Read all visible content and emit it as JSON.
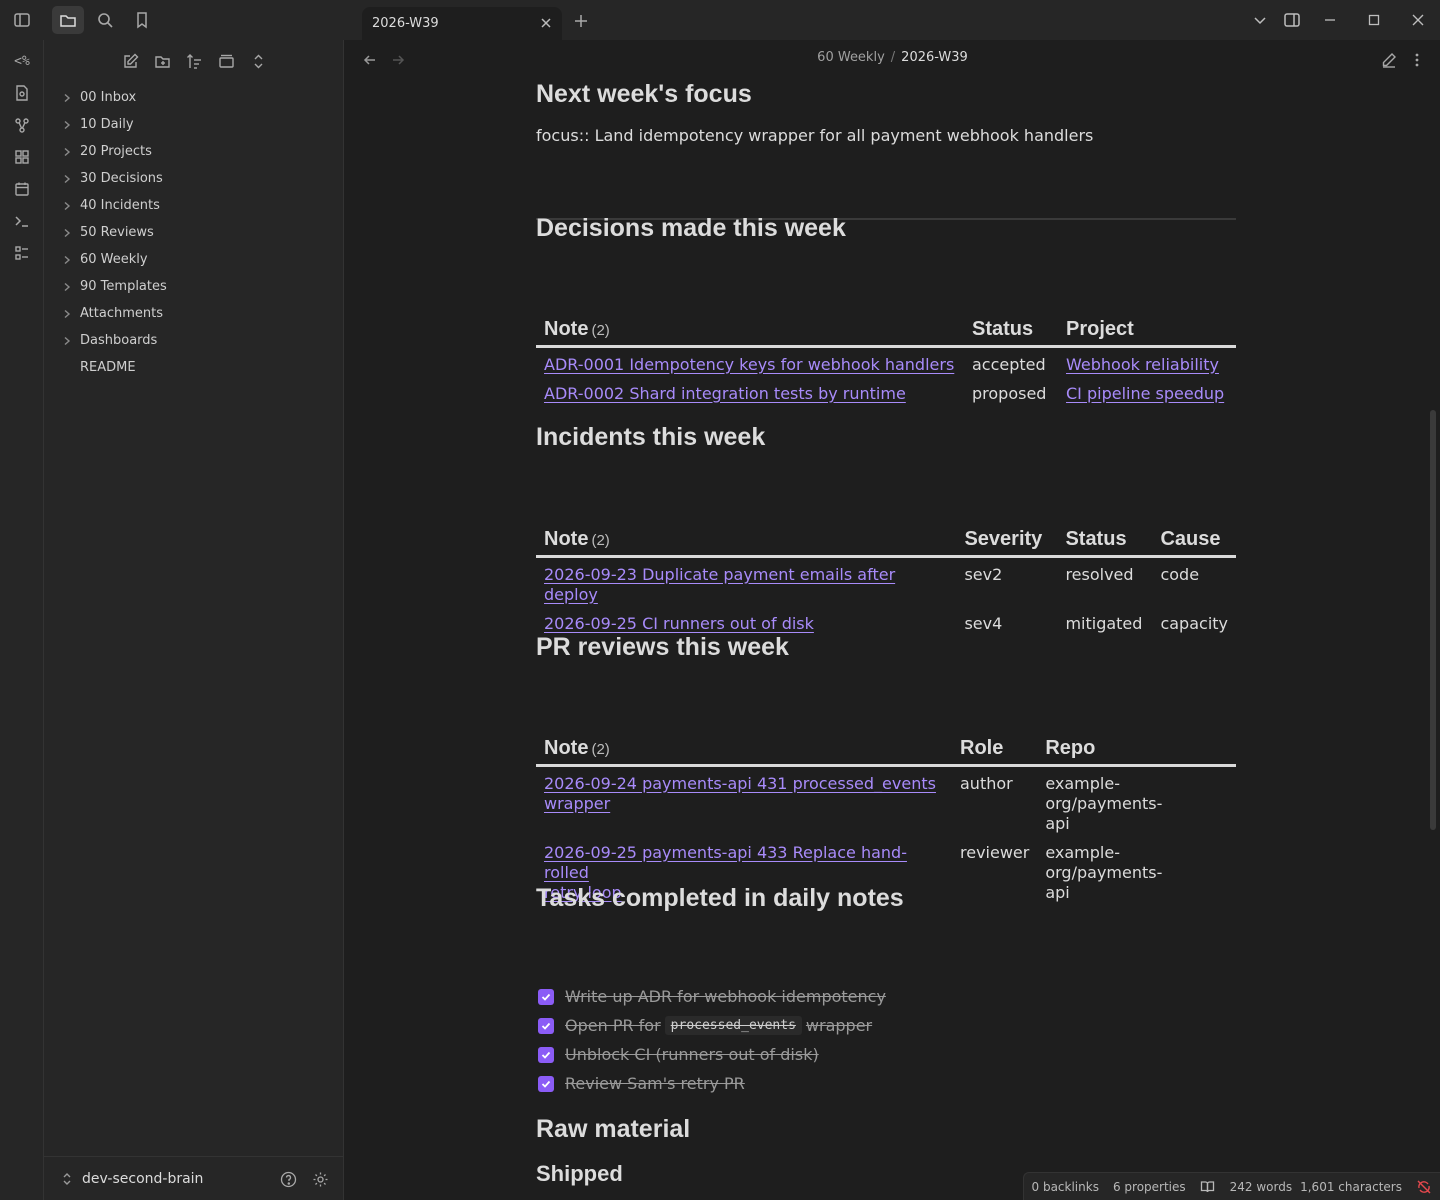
{
  "tab": {
    "title": "2026-W39"
  },
  "ribbon": {
    "templater_label": "<%"
  },
  "sidebar": {
    "tree": [
      {
        "label": "00 Inbox",
        "folder": true
      },
      {
        "label": "10 Daily",
        "folder": true
      },
      {
        "label": "20 Projects",
        "folder": true
      },
      {
        "label": "30 Decisions",
        "folder": true
      },
      {
        "label": "40 Incidents",
        "folder": true
      },
      {
        "label": "50 Reviews",
        "folder": true
      },
      {
        "label": "60 Weekly",
        "folder": true
      },
      {
        "label": "90 Templates",
        "folder": true
      },
      {
        "label": "Attachments",
        "folder": true
      },
      {
        "label": "Dashboards",
        "folder": true
      },
      {
        "label": "README",
        "folder": false
      }
    ],
    "vault_name": "dev-second-brain"
  },
  "breadcrumb": {
    "parent": "60 Weekly",
    "separator": "/",
    "current": "2026-W39"
  },
  "doc": {
    "focus": {
      "heading": "Next week's focus",
      "text": "focus:: Land idempotency wrapper for all payment webhook handlers"
    },
    "decisions": {
      "heading": "Decisions made this week",
      "columns": [
        "Note",
        "Status",
        "Project"
      ],
      "count": "(2)",
      "rows": [
        {
          "note": "ADR-0001 Idempotency keys for webhook handlers",
          "status": "accepted",
          "project": "Webhook reliability"
        },
        {
          "note": "ADR-0002 Shard integration tests by runtime",
          "status": "proposed",
          "project": "CI pipeline speedup"
        }
      ]
    },
    "incidents": {
      "heading": "Incidents this week",
      "columns": [
        "Note",
        "Severity",
        "Status",
        "Cause"
      ],
      "count": "(2)",
      "rows": [
        {
          "note": "2026-09-23 Duplicate payment emails after deploy",
          "severity": "sev2",
          "status": "resolved",
          "cause": "code"
        },
        {
          "note": "2026-09-25 CI runners out of disk",
          "severity": "sev4",
          "status": "mitigated",
          "cause": "capacity"
        }
      ]
    },
    "reviews": {
      "heading": "PR reviews this week",
      "columns": [
        "Note",
        "Role",
        "Repo"
      ],
      "count": "(2)",
      "rows": [
        {
          "note_line1": "2026-09-24 payments-api 431 processed_events",
          "note_line2": "wrapper",
          "role": "author",
          "repo_line1": "example-org/payments-",
          "repo_line2": "api"
        },
        {
          "note_line1": "2026-09-25 payments-api 433 Replace hand-rolled",
          "note_line2": "retry loop",
          "role": "reviewer",
          "repo_line1": "example-org/payments-",
          "repo_line2": "api"
        }
      ]
    },
    "tasks": {
      "heading": "Tasks completed in daily notes",
      "items": [
        {
          "text": "Write up ADR for webhook idempotency"
        },
        {
          "pre": "Open PR for",
          "code": "processed_events",
          "post": "wrapper"
        },
        {
          "text": "Unblock CI (runners out of disk)"
        },
        {
          "text": "Review Sam's retry PR"
        }
      ]
    },
    "raw": {
      "heading": "Raw material",
      "subheading": "Shipped"
    }
  },
  "status": {
    "backlinks": "0 backlinks",
    "properties": "6 properties",
    "words": "242 words",
    "characters": "1,601 characters"
  },
  "colors": {
    "accent": "#8b5cf6",
    "link": "#a88bfa",
    "background": "#1e1e1e",
    "panel": "#262626"
  }
}
